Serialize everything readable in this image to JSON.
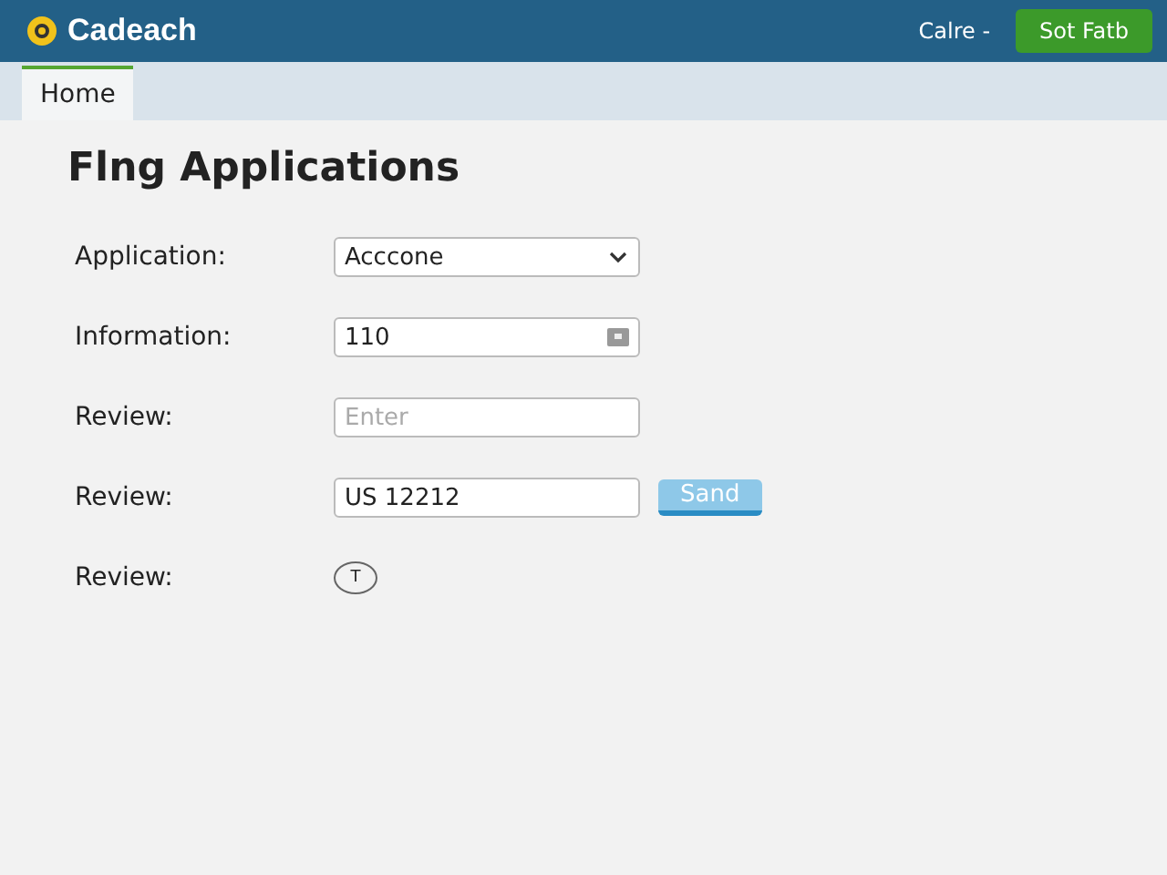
{
  "header": {
    "brand": "Cadeach",
    "user_menu": "Calre -",
    "action_button": "Sot Fatb"
  },
  "tabs": [
    {
      "label": "Home",
      "selected": true
    }
  ],
  "form": {
    "title": "Flng Applications",
    "rows": [
      {
        "kind": "select",
        "label": "Application:",
        "value": "Acccone"
      },
      {
        "kind": "input_icon",
        "label": "Information:",
        "value": "110"
      },
      {
        "kind": "placeholder",
        "label": "Review:",
        "placeholder": "Enter"
      },
      {
        "kind": "input_button",
        "label": "Review:",
        "value": "US 12212",
        "button": "Sand"
      },
      {
        "kind": "circle",
        "label": "Review:",
        "value": "T"
      }
    ]
  }
}
